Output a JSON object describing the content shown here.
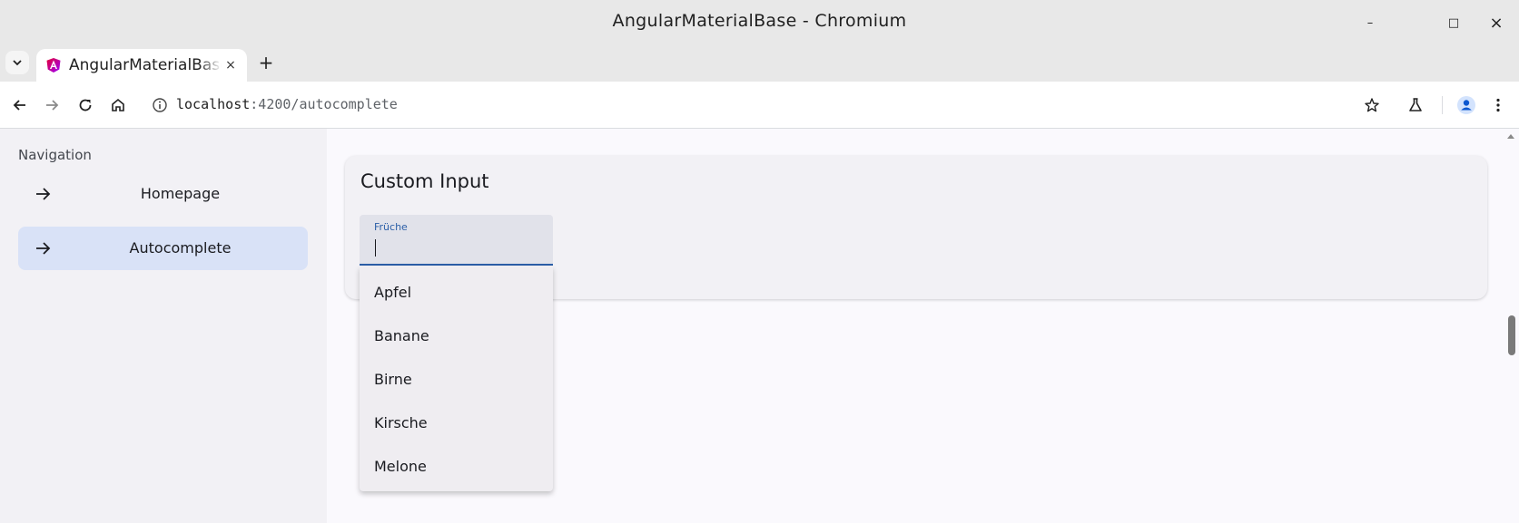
{
  "window": {
    "title": "AngularMaterialBase - Chromium",
    "controls": {
      "minimize": "–",
      "maximize": "□",
      "close": "×"
    }
  },
  "tabs": [
    {
      "title": "AngularMaterialBase",
      "icon": "angular-logo-icon",
      "active": true
    }
  ],
  "tabstrip": {
    "new_tab": "+",
    "close": "×"
  },
  "toolbar": {
    "url_host": "localhost",
    "url_rest": ":4200/autocomplete",
    "icons": [
      "back-arrow-icon",
      "forward-arrow-icon",
      "reload-icon",
      "home-icon",
      "site-info-icon",
      "bookmark-star-icon",
      "labs-flask-icon",
      "profile-icon",
      "more-menu-icon"
    ]
  },
  "nav": {
    "heading": "Navigation",
    "items": [
      {
        "label": "Homepage",
        "active": false
      },
      {
        "label": "Autocomplete",
        "active": true
      }
    ]
  },
  "card": {
    "title": "Custom Input",
    "field": {
      "label": "Früche",
      "value": ""
    }
  },
  "autocomplete": {
    "options": [
      "Apfel",
      "Banane",
      "Birne",
      "Kirsche",
      "Melone"
    ]
  },
  "colors": {
    "accent": "#2b5ea7",
    "active_nav": "#d9e2f7",
    "page_bg": "#faf9fd",
    "sidenav_bg": "#f2f1f5"
  }
}
